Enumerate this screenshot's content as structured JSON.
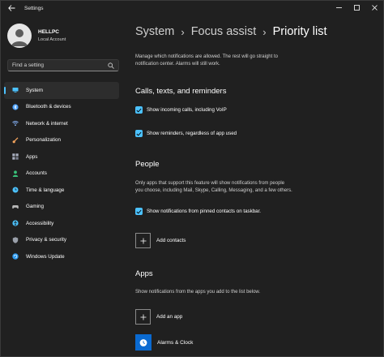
{
  "window": {
    "title": "Settings"
  },
  "user": {
    "name": "HELLPC",
    "account_type": "Local Account"
  },
  "search": {
    "placeholder": "Find a setting"
  },
  "sidebar": {
    "items": [
      {
        "label": "System",
        "icon": "monitor-icon",
        "color": "#4cc2ff",
        "active": true
      },
      {
        "label": "Bluetooth & devices",
        "icon": "bluetooth-icon",
        "color": "#4aa0ff"
      },
      {
        "label": "Network & internet",
        "icon": "wifi-icon",
        "color": "#8ab8ff"
      },
      {
        "label": "Personalization",
        "icon": "brush-icon",
        "color": "#f1a25c"
      },
      {
        "label": "Apps",
        "icon": "apps-icon",
        "color": "#aab0c0"
      },
      {
        "label": "Accounts",
        "icon": "person-icon",
        "color": "#39c17a"
      },
      {
        "label": "Time & language",
        "icon": "globe-clock-icon",
        "color": "#4cc2ff"
      },
      {
        "label": "Gaming",
        "icon": "gamepad-icon",
        "color": "#b8b8b8"
      },
      {
        "label": "Accessibility",
        "icon": "accessibility-icon",
        "color": "#4cc2ff"
      },
      {
        "label": "Privacy & security",
        "icon": "shield-icon",
        "color": "#9aa0aa"
      },
      {
        "label": "Windows Update",
        "icon": "update-icon",
        "color": "#2d9bf0"
      }
    ]
  },
  "breadcrumb": {
    "part1": "System",
    "part2": "Focus assist",
    "current": "Priority list"
  },
  "intro": {
    "line1": "Manage which notifications are allowed. The rest will go straight to",
    "line2": "notification center. Alarms will still work."
  },
  "calls": {
    "title": "Calls, texts, and reminders",
    "option1": "Show incoming calls, including VoIP",
    "option2": "Show reminders, regardless of app used"
  },
  "people": {
    "title": "People",
    "desc1": "Only apps that support this feature will show notifications from people",
    "desc2": "you choose, including Mail, Skype, Calling, Messaging, and a few others.",
    "option1": "Show notifications from pinned contacts on taskbar.",
    "add_label": "Add contacts"
  },
  "apps": {
    "title": "Apps",
    "desc": "Show notifications from the apps you add to the list below.",
    "add_label": "Add an app",
    "list": [
      {
        "label": "Alarms & Clock"
      }
    ]
  },
  "colors": {
    "accent": "#4cc2ff",
    "background": "#202020",
    "app_tile": "#0a6ad1"
  }
}
